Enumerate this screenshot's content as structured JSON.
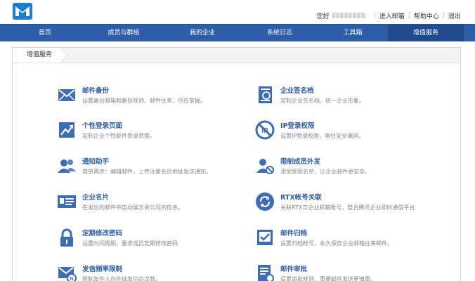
{
  "header": {
    "greeting": "您好",
    "links": [
      "进入邮箱",
      "帮助中心",
      "退出"
    ]
  },
  "nav": {
    "items": [
      "首页",
      "成员与群组",
      "我的企业",
      "系统日志",
      "工具箱",
      "增值服务"
    ],
    "active_index": 5
  },
  "breadcrumb": "增值服务",
  "colors": {
    "nav": "#2f5ea8",
    "nav_active": "#214a8c",
    "icon": "#3c6db5",
    "title": "#2f5ea8"
  },
  "services": [
    {
      "title": "邮件备份",
      "desc": "设置备份邮箱和备份规则，邮件往来，尽在掌握。",
      "icon": "envelope-icon"
    },
    {
      "title": "企业签名档",
      "desc": "定制企业签名档，统一企业形象。",
      "icon": "signature-doc-icon"
    },
    {
      "title": "个性登录页面",
      "desc": "定制企业个性邮件登录页面。",
      "icon": "custom-login-icon"
    },
    {
      "title": "IP登录权限",
      "desc": "设置IP登录权限，堵住安全漏洞。",
      "icon": "ip-restrict-icon"
    },
    {
      "title": "通知助手",
      "desc": "简单两步：编辑邮件，上传注册会员地址发送通知。",
      "icon": "notify-users-icon"
    },
    {
      "title": "限制成员外发",
      "desc": "添加受限名单，让企业邮件更安全。",
      "icon": "restrict-user-icon"
    },
    {
      "title": "企业名片",
      "desc": "在发出的邮件中自动展示贵公司的信息。",
      "icon": "business-card-icon"
    },
    {
      "title": "RTX帐号关联",
      "desc": "关联RTX与企业邮箱帐号，整合腾讯企业即时通信平台",
      "icon": "sync-icon"
    },
    {
      "title": "定期修改密码",
      "desc": "设置时间周期，要求成员定期修改密码",
      "icon": "lock-icon"
    },
    {
      "title": "邮件归档",
      "desc": "设置归档帐号，永久保存企业邮箱往来邮件。",
      "icon": "archive-icon"
    },
    {
      "title": "发信频率限制",
      "desc": "限制发件人向外域发信的次数。",
      "icon": "rate-limit-icon"
    },
    {
      "title": "邮件审批",
      "desc": "设置审批规则，重要邮件发送更慎重。",
      "icon": "approval-icon"
    }
  ]
}
